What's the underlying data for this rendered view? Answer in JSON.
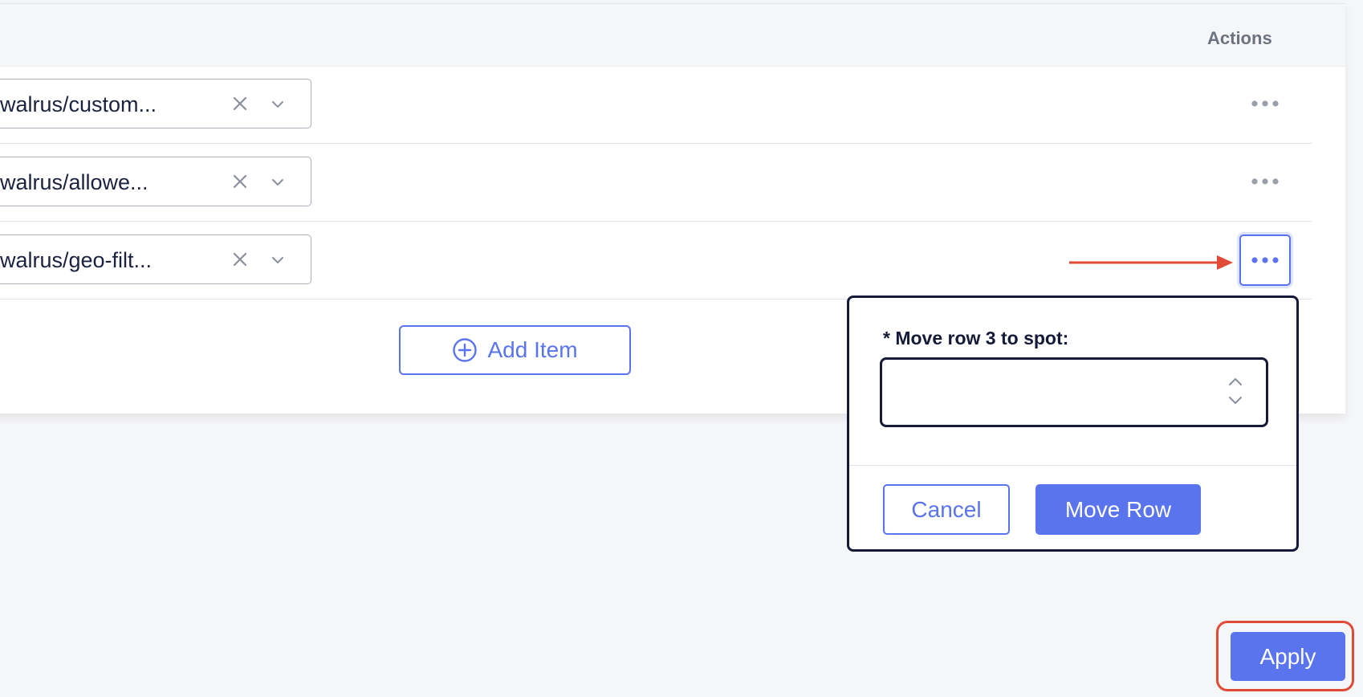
{
  "table": {
    "actions_header": "Actions",
    "rows": [
      {
        "value": "-walrus/custom..."
      },
      {
        "value": "-walrus/allowe..."
      },
      {
        "value": "-walrus/geo-filt..."
      }
    ],
    "add_item_label": "Add Item"
  },
  "popover": {
    "label": "* Move row 3 to spot:",
    "input_value": "",
    "cancel_label": "Cancel",
    "move_label": "Move Row"
  },
  "footer": {
    "apply_label": "Apply"
  },
  "colors": {
    "accent": "#5a74ee",
    "dark_border": "#141a38",
    "annotation": "#e04a37",
    "background": "#f5f6f8"
  }
}
